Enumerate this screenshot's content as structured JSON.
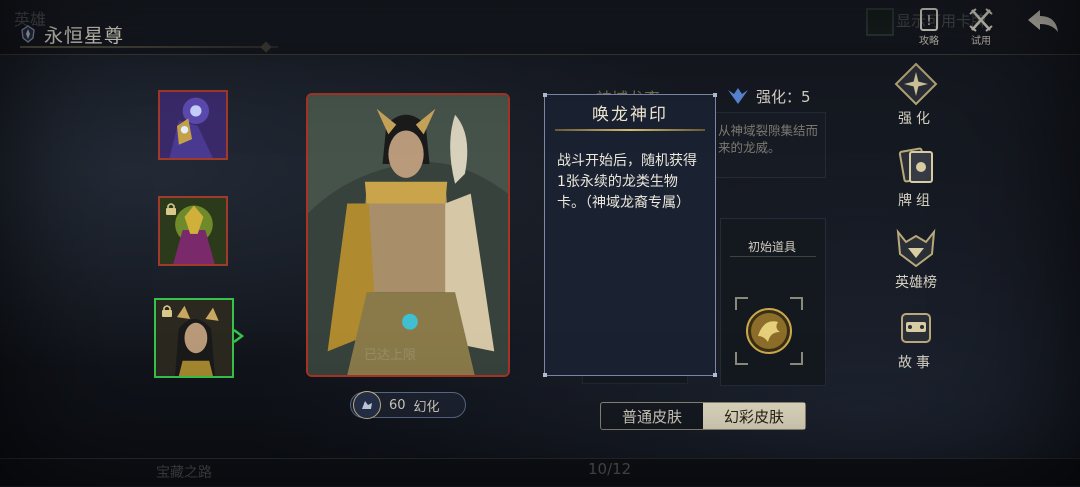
{
  "header": {
    "ghost_label": "英雄",
    "title": "永恒星尊",
    "toggle_label": "显示可用卡牌",
    "guide_label": "攻略",
    "trial_label": "试用"
  },
  "hero_list": {
    "count": "10/12",
    "bottom_left_label": "宝藏之路"
  },
  "card": {
    "watermark": "已达上限"
  },
  "skin": {
    "count": "60",
    "count_label": "幻化",
    "normal_label": "普通皮肤",
    "fancy_label": "幻彩皮肤"
  },
  "hero_info": {
    "subtitle": "神域龙裔",
    "enhance_label": "强化：5",
    "desc_partial": "从神域裂隙集结而来的龙威。",
    "start_item_label": "初始道具"
  },
  "tooltip": {
    "title": "唤龙神印",
    "body": "战斗开始后，随机获得1张永续的龙类生物卡。（神域龙裔专属）"
  },
  "right_menu": {
    "enhance": "强化",
    "deck": "牌组",
    "ranking": "英雄榜",
    "story": "故事"
  }
}
